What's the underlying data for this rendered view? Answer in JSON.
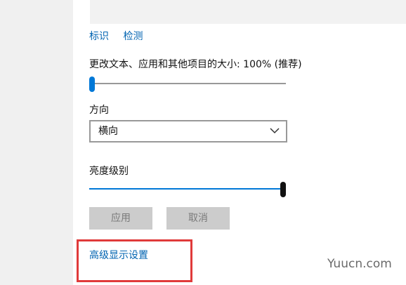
{
  "links": {
    "identify": "标识",
    "detect": "检测"
  },
  "scale": {
    "label": "更改文本、应用和其他项目的大小: 100% (推荐)",
    "value_fraction": 0.0
  },
  "orientation": {
    "label": "方向",
    "selected": "横向"
  },
  "brightness": {
    "label": "亮度级别",
    "value_fraction": 1.0
  },
  "buttons": {
    "apply": "应用",
    "cancel": "取消"
  },
  "advanced": {
    "link": "高级显示设置"
  },
  "watermark": "Yuucn.com",
  "colors": {
    "accent": "#0078d7",
    "link": "#0063b1",
    "highlight_box": "#e03a3a"
  }
}
